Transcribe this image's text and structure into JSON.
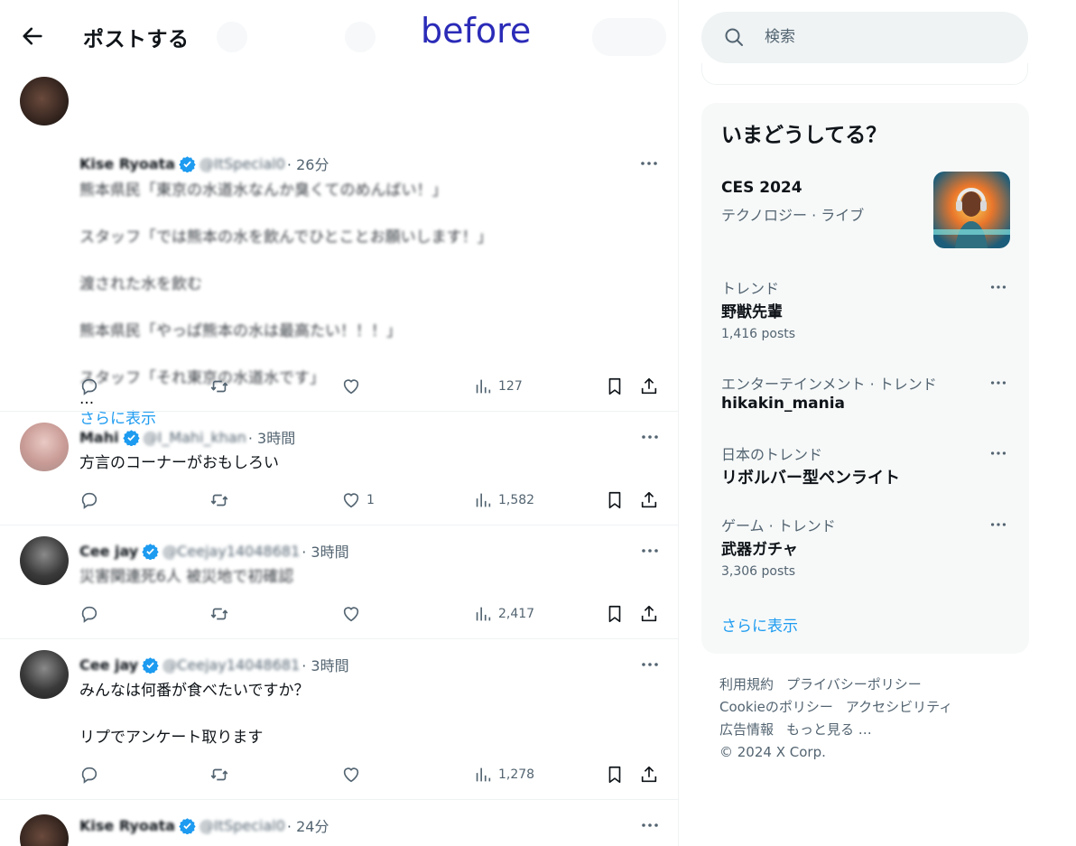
{
  "header": {
    "title": "ポストする",
    "overlay_label": "before"
  },
  "posts": [
    {
      "name": "Kise Ryoata",
      "handle": "@ItSpecial0",
      "time": "· 26分",
      "text_blurred": "熊本県民「東京の水道水なんか臭くてのめんばい！」\n\nスタッフ「では熊本の水を飲んでひとことお願いします！」\n\n渡された水を飲む\n\n熊本県民「やっぱ熊本の水は最高たい！！！」\n\nスタッフ「それ東京の水道水です」",
      "ellipsis": "...",
      "show_more": "さらに表示",
      "likes": "",
      "views": "127"
    },
    {
      "name": "Mahi",
      "handle": "@I_Mahi_khan",
      "time": "· 3時間",
      "text": "方言のコーナーがおもしろい",
      "likes": "1",
      "views": "1,582"
    },
    {
      "name": "Cee jay",
      "handle": "@Ceejay14048681",
      "time": "· 3時間",
      "text_blurred": "災害関連死6人 被災地で初確認",
      "likes": "",
      "views": "2,417"
    },
    {
      "name": "Cee jay",
      "handle": "@Ceejay14048681",
      "time": "· 3時間",
      "text": "みんなは何番が食べたいですか？\n\nリプでアンケート取ります",
      "likes": "",
      "views": "1,278"
    },
    {
      "name": "Kise Ryoata",
      "handle": "@ItSpecial0",
      "time": "· 24分"
    }
  ],
  "search": {
    "placeholder": "検索"
  },
  "trends": {
    "title": "いまどうしてる？",
    "feature": {
      "title": "CES 2024",
      "subtitle": "テクノロジー · ライブ"
    },
    "items": [
      {
        "category": "トレンド",
        "name": "野獣先輩",
        "count": "1,416 posts"
      },
      {
        "category": "エンターテインメント · トレンド",
        "name": "hikakin_mania",
        "count": ""
      },
      {
        "category": "日本のトレンド",
        "name": "リボルバー型ペンライト",
        "count": ""
      },
      {
        "category": "ゲーム · トレンド",
        "name": "武器ガチャ",
        "count": "3,306 posts"
      }
    ],
    "show_more": "さらに表示"
  },
  "footer": {
    "links_row1": [
      "利用規約",
      "プライバシーポリシー"
    ],
    "links_row2": [
      "Cookieのポリシー",
      "アクセシビリティ"
    ],
    "links_row3": [
      "広告情報",
      "もっと見る …"
    ],
    "copyright": "© 2024 X Corp."
  },
  "colors": {
    "accent": "#1d9bf0",
    "verified": "#1d9bf0",
    "overlay_label": "#2b2bb8",
    "muted": "#536471"
  }
}
